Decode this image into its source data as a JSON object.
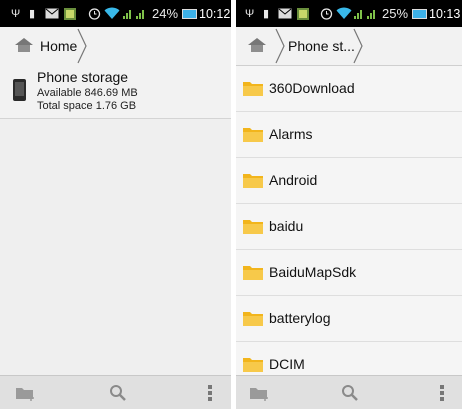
{
  "left": {
    "status": {
      "percent": "24%",
      "time": "10:12"
    },
    "breadcrumb": {
      "items": [
        "Home"
      ]
    },
    "storage": {
      "title": "Phone storage",
      "available": "Available 846.69 MB",
      "total": "Total space 1.76 GB"
    }
  },
  "right": {
    "status": {
      "percent": "25%",
      "time": "10:13"
    },
    "breadcrumb": {
      "items": [
        "Phone st..."
      ]
    },
    "folders": [
      "360Download",
      "Alarms",
      "Android",
      "baidu",
      "BaiduMapSdk",
      "batterylog",
      "DCIM"
    ]
  },
  "colors": {
    "folder": "#f2b51c",
    "wifi": "#39b9ea",
    "battery": "#3db1e8",
    "signal": "#7fc24a"
  },
  "icons": [
    "usb-icon",
    "sd-icon",
    "mail-icon",
    "image-icon",
    "alarm-icon",
    "wifi-icon",
    "signal-icon",
    "battery-icon",
    "home-icon",
    "phone-icon",
    "folder-icon",
    "new-folder-icon",
    "search-icon",
    "overflow-menu-icon"
  ]
}
